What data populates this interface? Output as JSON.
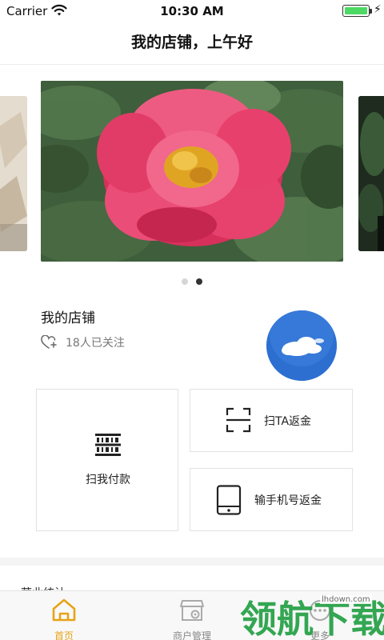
{
  "status_bar": {
    "carrier": "Carrier",
    "time": "10:30 AM",
    "bolt": "⚡"
  },
  "nav": {
    "title": "我的店铺，上午好"
  },
  "carousel": {
    "slides": [
      "garden-scene",
      "pink-peony-flower",
      "dark-plant"
    ],
    "active_index": 1,
    "dot_count": 2,
    "active_dot": 1
  },
  "shop": {
    "name": "我的店铺",
    "followers": "18人已关注"
  },
  "actions": {
    "scan_pay": "扫我付款",
    "scan_ta": "扫TA返金",
    "phone_cashback": "输手机号返金"
  },
  "section": {
    "title": "营业统计"
  },
  "tabs": [
    {
      "label": "首页",
      "icon": "home-icon",
      "active": true
    },
    {
      "label": "商户管理",
      "icon": "store-icon",
      "active": false
    },
    {
      "label": "更多",
      "icon": "more-icon",
      "active": false
    }
  ],
  "watermark": {
    "brand": "领航下载",
    "url": "lhdown.com"
  },
  "colors": {
    "accent": "#e8a317",
    "battery": "#4cd964",
    "avatar_sky": "#2c6fcf",
    "flower": "#e8396a"
  }
}
